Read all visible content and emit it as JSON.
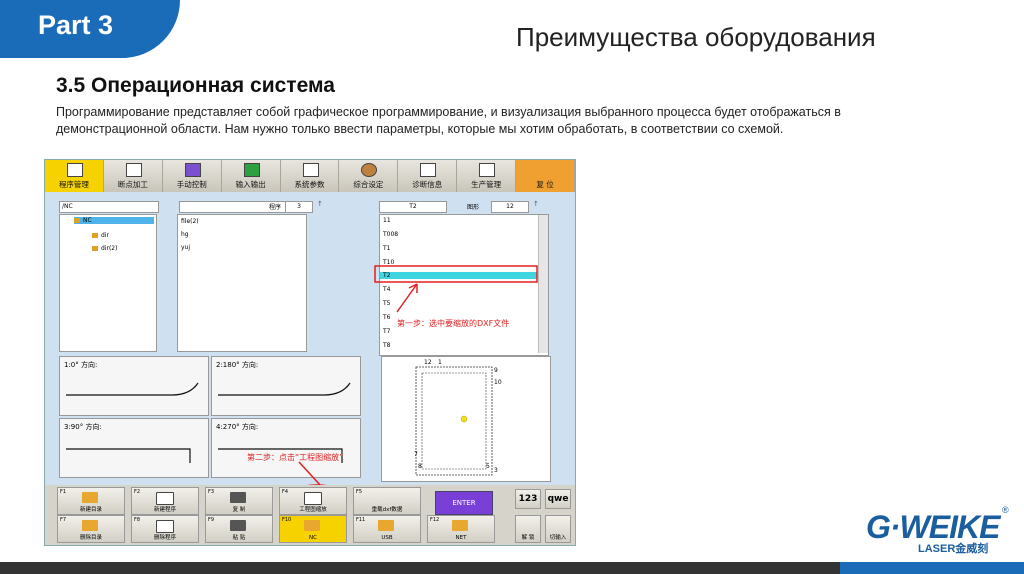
{
  "header": {
    "part": "Part 3",
    "title": "Преимущества оборудования"
  },
  "section": {
    "title": "3.5 Операционная система",
    "description": "Программирование представляет собой графическое программирование, и визуализация выбранного процесса будет отображаться в демонстрационной области. Нам нужно только ввести параметры, которые мы хотим обработать, в соответствии со схемой."
  },
  "toolbar": [
    {
      "label": "程序管理",
      "icon": "save-icon"
    },
    {
      "label": "断点加工",
      "icon": "tool-icon"
    },
    {
      "label": "手动控制",
      "icon": "hand-icon"
    },
    {
      "label": "输入输出",
      "icon": "io-icon"
    },
    {
      "label": "系统参数",
      "icon": "grid-icon"
    },
    {
      "label": "综合设定",
      "icon": "gear-icon"
    },
    {
      "label": "诊断信息",
      "icon": "document-icon"
    },
    {
      "label": "生产管理",
      "icon": "list-icon"
    },
    {
      "label": "复 位",
      "icon": "reset-icon"
    }
  ],
  "file_manager": {
    "path": "/NC",
    "program_label": "程序",
    "program_value": "3",
    "tree": [
      "NC",
      "dir",
      "dir(2)"
    ],
    "files": [
      "file(2)",
      "hg",
      "yuj"
    ]
  },
  "right_panel": {
    "header": "T2",
    "graphic_label": "图形",
    "graphic_value": "12",
    "items": [
      "11",
      "T008",
      "T1",
      "T10",
      "T2",
      "T4",
      "T5",
      "T6",
      "T7",
      "T8"
    ],
    "selected": "T2"
  },
  "directions": [
    {
      "label": "1:0° 方向:"
    },
    {
      "label": "2:180° 方向:"
    },
    {
      "label": "3:90° 方向:"
    },
    {
      "label": "4:270° 方向:"
    }
  ],
  "preview_labels": [
    "12",
    "1",
    "9",
    "10",
    "8",
    "7",
    "5",
    "3"
  ],
  "annotations": {
    "step1": "第一步：选中要缩放的DXF文件",
    "step2": "第二步：点击“工程图缩放”"
  },
  "fkeys": [
    {
      "fn": "F1",
      "label": "新建目录"
    },
    {
      "fn": "F2",
      "label": "新建程序"
    },
    {
      "fn": "F3",
      "label": "复 制"
    },
    {
      "fn": "F4",
      "label": "工程图缩放"
    },
    {
      "fn": "F5",
      "label": "重载dxf数据"
    },
    {
      "fn": "F7",
      "label": "删除目录"
    },
    {
      "fn": "F8",
      "label": "删除程序"
    },
    {
      "fn": "F9",
      "label": "粘 贴"
    },
    {
      "fn": "F10",
      "label": "NC"
    },
    {
      "fn": "F11",
      "label": "USB"
    },
    {
      "fn": "F12",
      "label": "NET"
    }
  ],
  "side_keys": {
    "enter": "ENTER",
    "num": "123",
    "qwe": "qwe",
    "unlock": "解 锁",
    "input": "切输入"
  },
  "brand": {
    "logo": "G·WEIKE",
    "sub": "LASER金威刻",
    "reg": "®"
  }
}
